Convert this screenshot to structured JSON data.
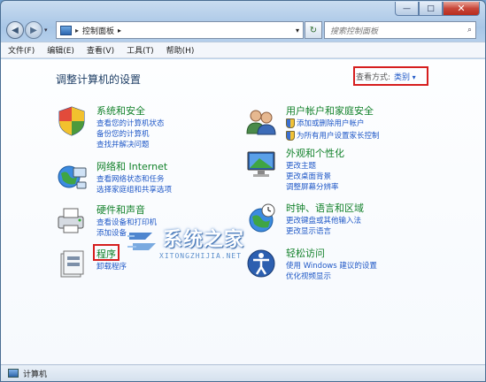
{
  "address_bar": {
    "crumb": "控制面板",
    "search_placeholder": "搜索控制面板"
  },
  "menu": [
    "文件(F)",
    "编辑(E)",
    "查看(V)",
    "工具(T)",
    "帮助(H)"
  ],
  "page_title": "调整计算机的设置",
  "view_by": {
    "label": "查看方式:",
    "value": "类别"
  },
  "categories_left": [
    {
      "title": "系统和安全",
      "links": [
        "查看您的计算机状态",
        "备份您的计算机",
        "查找并解决问题"
      ],
      "icon": "shield-icon"
    },
    {
      "title": "网络和 Internet",
      "links": [
        "查看网络状态和任务",
        "选择家庭组和共享选项"
      ],
      "icon": "network-globe-icon"
    },
    {
      "title": "硬件和声音",
      "links": [
        "查看设备和打印机",
        "添加设备"
      ],
      "icon": "printer-icon"
    },
    {
      "title": "程序",
      "links": [
        "卸载程序"
      ],
      "icon": "programs-icon"
    }
  ],
  "categories_right": [
    {
      "title": "用户帐户和家庭安全",
      "links": [
        "添加或删除用户帐户",
        "为所有用户设置家长控制"
      ],
      "icon": "users-icon"
    },
    {
      "title": "外观和个性化",
      "links": [
        "更改主题",
        "更改桌面背景",
        "调整屏幕分辨率"
      ],
      "icon": "monitor-icon"
    },
    {
      "title": "时钟、语言和区域",
      "links": [
        "更改键盘或其他输入法",
        "更改显示语言"
      ],
      "icon": "clock-globe-icon"
    },
    {
      "title": "轻松访问",
      "links": [
        "使用 Windows 建议的设置",
        "优化视频显示"
      ],
      "icon": "accessibility-icon"
    }
  ],
  "watermark": {
    "text": "系统之家",
    "url": "XITONGZHIJIA.NET"
  },
  "status_bar": {
    "label": "计算机"
  },
  "colors": {
    "link": "#1f58c7",
    "category_title": "#12812a",
    "highlight_box": "#d61e1e"
  }
}
